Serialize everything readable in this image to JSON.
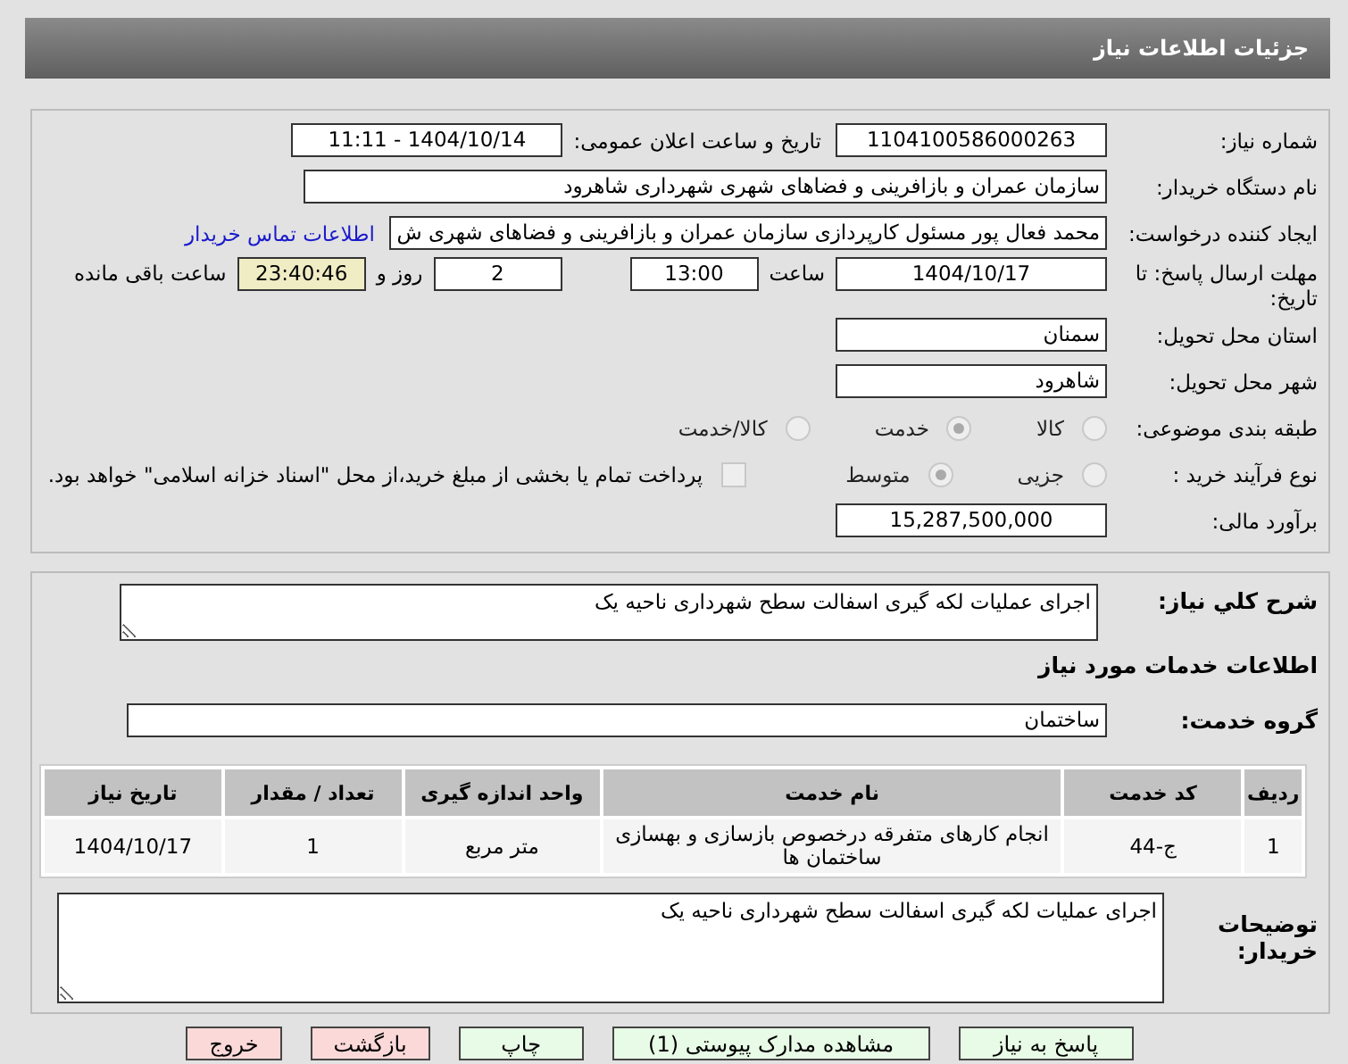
{
  "window": {
    "title": "جزئیات اطلاعات نیاز"
  },
  "details": {
    "need_number": {
      "label": "شماره نیاز:",
      "value": "1104100586000263"
    },
    "announce_date": {
      "label": "تاریخ و ساعت اعلان عمومی:",
      "value": "1404/10/14 - 11:11"
    },
    "buyer_org": {
      "label": "نام دستگاه خریدار:",
      "value": "سازمان عمران و بازافرینی و فضاهای شهری شهرداری شاهرود"
    },
    "requester": {
      "label": "ایجاد کننده درخواست:",
      "value": "محمد فعال پور مسئول کارپردازی سازمان عمران و بازافرینی و فضاهای شهری ش",
      "link": "اطلاعات تماس خریدار"
    },
    "deadline": {
      "label": "مهلت ارسال پاسخ: تا تاریخ:",
      "date": "1404/10/17",
      "time_label": "ساعت",
      "time": "13:00",
      "days": "2",
      "days_label": "روز و",
      "remaining": "23:40:46",
      "remaining_label": "ساعت باقی مانده"
    },
    "province": {
      "label": "استان محل تحویل:",
      "value": "سمنان"
    },
    "city": {
      "label": "شهر محل تحویل:",
      "value": "شاهرود"
    },
    "category": {
      "label": "طبقه بندی موضوعی:",
      "options": [
        {
          "label": "کالا",
          "selected": false
        },
        {
          "label": "خدمت",
          "selected": true
        },
        {
          "label": "کالا/خدمت",
          "selected": false
        }
      ]
    },
    "process": {
      "label": "نوع فرآیند خرید :",
      "options": [
        {
          "label": "جزیی",
          "selected": false
        },
        {
          "label": "متوسط",
          "selected": true
        }
      ],
      "treasury": {
        "checked": false,
        "label": "پرداخت تمام یا بخشی از مبلغ خرید،از محل \"اسناد خزانه اسلامی\" خواهد بود."
      }
    },
    "budget": {
      "label": "برآورد مالی:",
      "value": "15,287,500,000"
    }
  },
  "services": {
    "summary": {
      "label": "شرح کلي نياز:",
      "value": "اجرای عملیات لکه گیری اسفالت سطح شهرداری ناحیه یک"
    },
    "heading": "اطلاعات خدمات مورد نیاز",
    "group": {
      "label": "گروه خدمت:",
      "value": "ساختمان"
    },
    "table": {
      "columns": [
        "ردیف",
        "کد خدمت",
        "نام خدمت",
        "واحد اندازه گیری",
        "تعداد / مقدار",
        "تاریخ نیاز"
      ],
      "rows": [
        [
          "1",
          "ج-44",
          "انجام کارهای متفرقه درخصوص بازسازی و بهسازی ساختمان ها",
          "متر مربع",
          "1",
          "1404/10/17"
        ]
      ]
    },
    "notes": {
      "label": "توضیحات خریدار:",
      "value": "اجرای عملیات لکه گیری اسفالت سطح شهرداری ناحیه یک"
    }
  },
  "buttons": [
    {
      "label": "پاسخ به نیاز",
      "kind": "action"
    },
    {
      "label": "مشاهده مدارک پیوستی (1)",
      "kind": "action"
    },
    {
      "label": "چاپ",
      "kind": "action"
    },
    {
      "label": "بازگشت",
      "kind": "exit"
    },
    {
      "label": "خروج",
      "kind": "exit"
    }
  ]
}
